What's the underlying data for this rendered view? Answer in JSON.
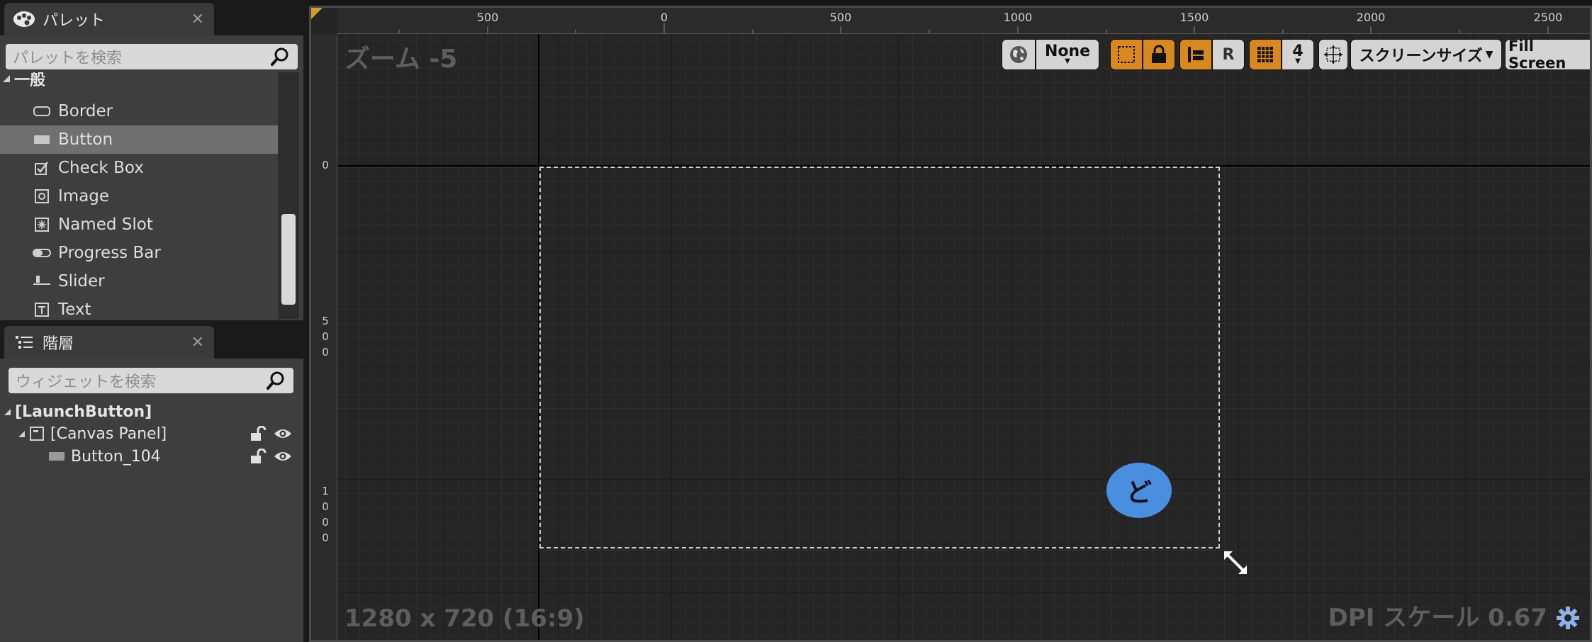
{
  "palette": {
    "tab_label": "パレット",
    "search_placeholder": "パレットを検索",
    "category": "一般",
    "items": [
      {
        "label": "Border",
        "icon": "border-icon"
      },
      {
        "label": "Button",
        "icon": "button-icon"
      },
      {
        "label": "Check Box",
        "icon": "checkbox-icon"
      },
      {
        "label": "Image",
        "icon": "image-icon"
      },
      {
        "label": "Named Slot",
        "icon": "named-slot-icon"
      },
      {
        "label": "Progress Bar",
        "icon": "progress-bar-icon"
      },
      {
        "label": "Slider",
        "icon": "slider-icon"
      },
      {
        "label": "Text",
        "icon": "text-icon"
      }
    ],
    "selected_item": "Button"
  },
  "hierarchy": {
    "tab_label": "階層",
    "search_placeholder": "ウィジェットを検索",
    "root": "[LaunchButton]",
    "canvas_panel": "[Canvas Panel]",
    "button": "Button_104"
  },
  "viewport": {
    "zoom": "ズーム -5",
    "resolution": "1280 x 720 (16:9)",
    "dpi": "DPI スケール 0.67",
    "ruler_top": [
      "500",
      "0",
      "500",
      "1000",
      "1500",
      "2000",
      "2500"
    ],
    "ruler_left": [
      [
        "0"
      ],
      [
        "5",
        "0",
        "0"
      ],
      [
        "1",
        "0",
        "0",
        "0"
      ]
    ],
    "toolbar": {
      "localization": "None",
      "rule": "R",
      "grid_size": "4",
      "screen_size": "スクリーンサイズ",
      "fill_screen": "Fill Screen"
    },
    "badge_text": "ど",
    "accent_orange": "#d8881e",
    "badge_blue": "#4a8ee0"
  }
}
